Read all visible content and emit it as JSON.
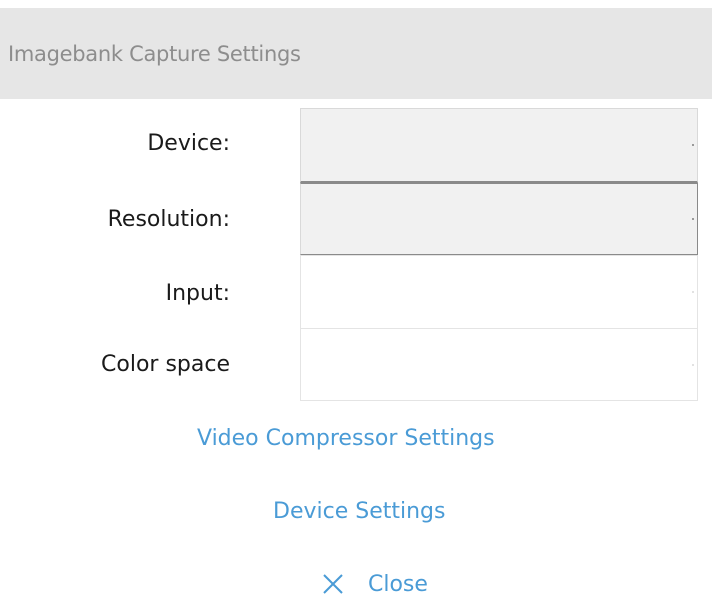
{
  "window": {
    "title": "Imagebank Capture Settings"
  },
  "form": {
    "device": {
      "label": "Device:",
      "value": ""
    },
    "resolution": {
      "label": "Resolution:",
      "value": ""
    },
    "input": {
      "label": "Input:",
      "value": ""
    },
    "color_space": {
      "label": "Color space",
      "value": ""
    }
  },
  "links": {
    "video_compressor": "Video Compressor Settings",
    "device_settings": "Device Settings",
    "close": "Close"
  },
  "colors": {
    "link": "#4a9bd6",
    "title_bar": "#e6e6e6",
    "title_text": "#8d8d8d"
  },
  "icons": {
    "close": "close-icon",
    "dropdown": "chevron-down-icon"
  }
}
